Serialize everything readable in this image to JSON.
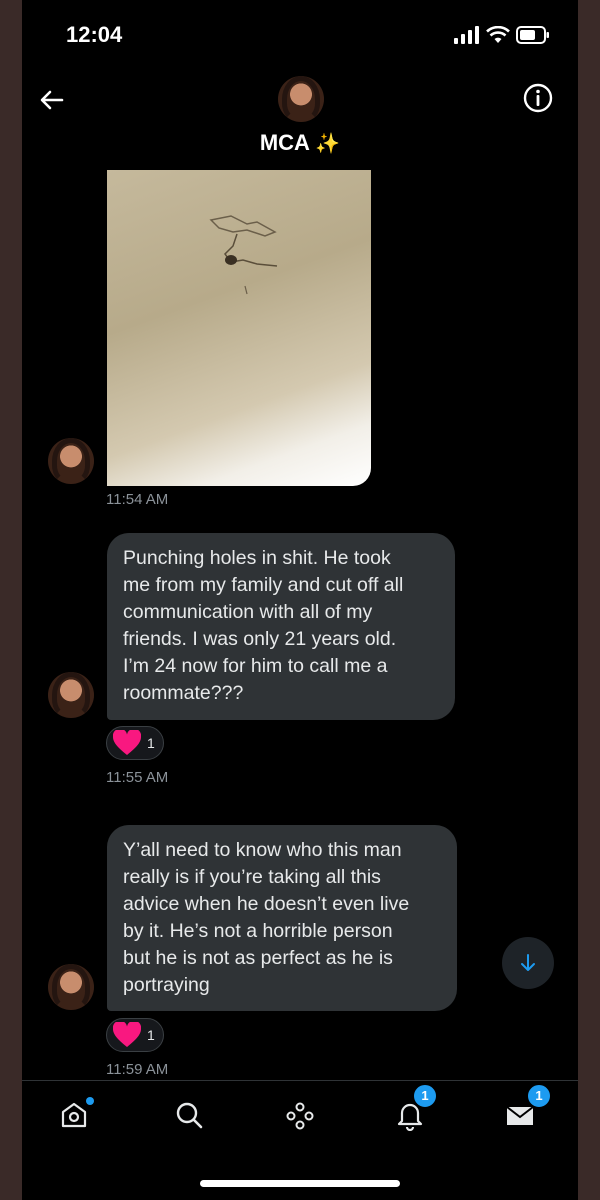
{
  "status_bar": {
    "time": "12:04"
  },
  "header": {
    "title": "MCA",
    "title_emoji": "✨"
  },
  "messages": [
    {
      "type": "media",
      "timestamp": "11:54 AM"
    },
    {
      "type": "text",
      "lines": [
        "Punching holes in shit. He took",
        "me from my family and cut off all",
        "communication with all of my",
        "friends. I was only 21 years old.",
        "I’m 24 now for him to call me a",
        "roommate???"
      ],
      "reaction_count": "1",
      "timestamp": "11:55 AM"
    },
    {
      "type": "text",
      "lines": [
        "Y’all need to know who this man",
        "really is if you’re taking all this",
        "advice when he doesn’t even live",
        "by it. He’s not a horrible person",
        "but he is not as perfect as he is",
        "portraying"
      ],
      "reaction_count": "1",
      "timestamp": "11:59 AM"
    }
  ],
  "tabbar": {
    "tabs": [
      {
        "name": "home",
        "icon": "home-icon"
      },
      {
        "name": "search",
        "icon": "search-icon"
      },
      {
        "name": "spaces",
        "icon": "spaces-icon"
      },
      {
        "name": "notifications",
        "icon": "bell-icon",
        "badge": "1"
      },
      {
        "name": "messages",
        "icon": "mail-icon",
        "badge": "1"
      }
    ]
  },
  "colors": {
    "accent": "#1d9bf0",
    "bubble": "#2f3336",
    "heart": "#f91880",
    "background": "#000000"
  }
}
